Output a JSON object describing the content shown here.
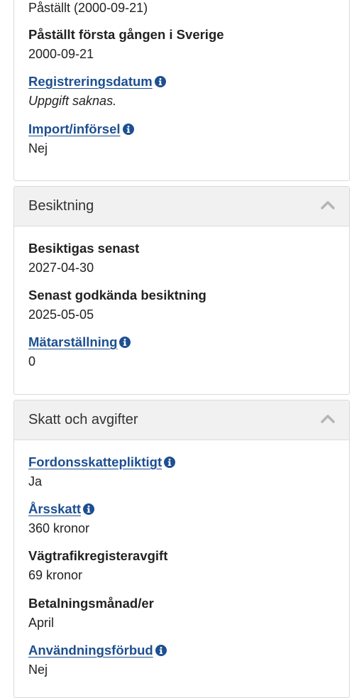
{
  "top_card": {
    "partial_text": "Påställt (2000-09-21)",
    "fields": [
      {
        "label": "Påställt första gången i Sverige",
        "value": "2000-09-21"
      },
      {
        "label": "Registreringsdatum",
        "value": "Uppgift saknas."
      },
      {
        "label": "Import/införsel",
        "value": "Nej"
      }
    ]
  },
  "inspection": {
    "title": "Besiktning",
    "fields": [
      {
        "label": "Besiktigas senast",
        "value": "2027-04-30"
      },
      {
        "label": "Senast godkända besiktning",
        "value": "2025-05-05"
      },
      {
        "label": "Mätarställning",
        "value": "0"
      }
    ]
  },
  "tax": {
    "title": "Skatt och avgifter",
    "fields": [
      {
        "label": "Fordonsskattepliktigt",
        "value": "Ja"
      },
      {
        "label": "Årsskatt",
        "value": "360 kronor"
      },
      {
        "label": "Vägtrafikregisteravgift",
        "value": "69 kronor"
      },
      {
        "label": "Betalningsmånad/er",
        "value": "April"
      },
      {
        "label": "Användningsförbud",
        "value": "Nej"
      }
    ]
  },
  "colors": {
    "link": "#1d4f91",
    "header_bg": "#f1f1f1",
    "border": "#d9d9d9"
  },
  "icons": {
    "info": "info-circle-icon",
    "collapse": "chevron-up-icon"
  }
}
